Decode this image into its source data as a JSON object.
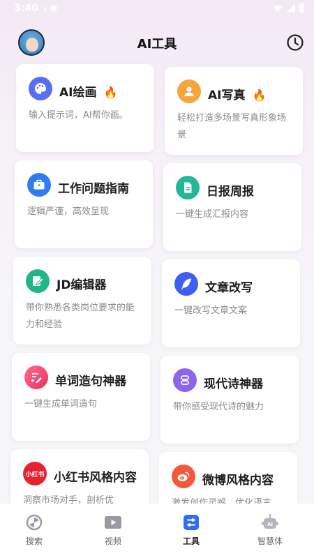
{
  "status_bar": {
    "time": "3:40"
  },
  "header": {
    "title": "AI工具"
  },
  "tools": [
    {
      "title": "AI绘画",
      "desc": "输入提示词，AI帮你画。",
      "hot": true,
      "icon": "palette-icon",
      "color": "#5a6ff0"
    },
    {
      "title": "AI写真",
      "desc": "轻松打造多场景写真形象场景",
      "hot": true,
      "icon": "portrait-icon",
      "color": "#f4a63a"
    },
    {
      "title": "工作问题指南",
      "desc": "逻辑严谨，高效呈现",
      "hot": false,
      "icon": "briefcase-icon",
      "color": "#2f7cf0"
    },
    {
      "title": "日报周报",
      "desc": "一键生成汇报内容",
      "hot": false,
      "icon": "document-icon",
      "color": "#23b796"
    },
    {
      "title": "JD编辑器",
      "desc": "带你熟悉各类岗位要求的能力和经验",
      "hot": false,
      "icon": "edit-icon",
      "color": "#21b784"
    },
    {
      "title": "文章改写",
      "desc": "一键改写文章文案",
      "hot": false,
      "icon": "feather-icon",
      "color": "#3f5ef2"
    },
    {
      "title": "单词造句神器",
      "desc": "一键生成单词造句",
      "hot": false,
      "icon": "sentence-icon",
      "color": "#f2466b"
    },
    {
      "title": "现代诗神器",
      "desc": "带你感受现代诗的魅力",
      "hot": false,
      "icon": "scroll-icon",
      "color": "#8e63ee"
    },
    {
      "title": "小红书风格内容",
      "desc": "洞察市场对手，剖析优",
      "hot": false,
      "icon": "xiaohongshu-icon",
      "icon_text": "小红书",
      "color": "#e8212f"
    },
    {
      "title": "微博风格内容",
      "desc": "激发创作灵感，优化语言",
      "hot": false,
      "icon": "weibo-icon",
      "color": "#f5593c"
    }
  ],
  "tabs": [
    {
      "label": "搜索",
      "icon": "search-icon",
      "active": false
    },
    {
      "label": "视频",
      "icon": "video-icon",
      "active": false
    },
    {
      "label": "工具",
      "icon": "tools-icon",
      "active": true
    },
    {
      "label": "智慧体",
      "icon": "robot-icon",
      "active": false
    }
  ],
  "colors": {
    "accent": "#2f6ef3",
    "fire": "#ff6a2c"
  }
}
